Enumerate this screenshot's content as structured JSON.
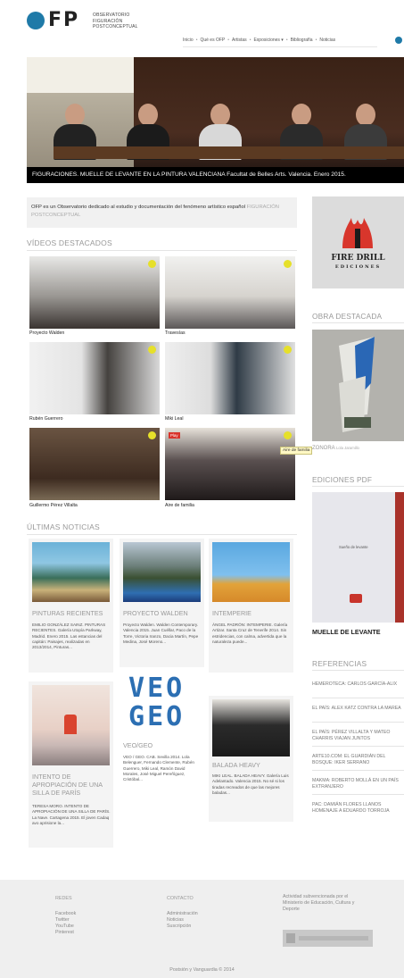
{
  "header": {
    "logo_letters": "FP",
    "logo_text": [
      "OBSERVATORIO",
      "FIGURACIÓN",
      "POSTCONCEPTUAL"
    ],
    "nav": [
      "Inicio",
      "Qué es OFP",
      "Artistas",
      "Exposiciones ▾",
      "Bibliografía",
      "Noticias"
    ]
  },
  "hero": {
    "caption": "FIGURACIONES. MUELLE DE LEVANTE EN LA PINTURA VALENCIANA Facultat de Belles Arts. Valencia. Enero 2015."
  },
  "intro": {
    "text": "OFP es un Observatorio dedicado al estudio y documentación del fenómeno artístico español",
    "muted": "FIGURACIÓN POSTCONCEPTUAL"
  },
  "videos": {
    "title": "VÍDEOS DESTACADOS",
    "items": [
      {
        "label": "Proyecto Walden"
      },
      {
        "label": "Travesías"
      },
      {
        "label": "Rubén Guerrero"
      },
      {
        "label": "Miki Leal"
      },
      {
        "label": "Guillermo Pérez Villalta"
      },
      {
        "label": "Aire de familia"
      }
    ],
    "tooltip": "Aire de familia",
    "badge": "Play"
  },
  "sidebar": {
    "logo_title": "FIRE DRILL",
    "logo_subtitle": "EDICIONES",
    "obra_title": "OBRA DESTACADA",
    "obra_caption": "ZONORA",
    "obra_author": "Lola Jaramillo",
    "pdf_title": "EDICIONES PDF",
    "pdf_cover_text": "Sueño de levante",
    "pdf_caption": "MUELLE DE LEVANTE",
    "refs_title": "REFERENCIAS",
    "refs": [
      "HEMEROTECA: CARLOS GARCÍA-ALIX",
      "EL PAÍS: ALEX KATZ CONTRA LA MAREA",
      "EL PAÍS: PÉREZ VILLALTA Y MATEO CHARRIS VIAJAN JUNTOS",
      "ARTE10.COM: EL GUARDIÁN DEL BOSQUE: IKER SERRANO",
      "MAKMA: ROBERTO MOLLÁ EN UN PAÍS EXTRANJERO",
      "PAC: DAMIÁN FLORES LLANOS HOMENAJE A EDUARDO TORROJA"
    ]
  },
  "news": {
    "title": "ÚLTIMAS NOTICIAS",
    "items": [
      {
        "title": "PINTURAS RECIENTES",
        "text": "EMILIO GONZÁLEZ SAINZ. PINTURAS RECIENTES. Galería Utopía Parkway, Madrid. Enero 2015. Las estancias del capitán: Paisajes, realizadas en 2013/2014, Pinturas..."
      },
      {
        "title": "PROYECTO WALDEN",
        "text": "Proyecto Walden. Walden Contemporary. Valencia 2015. Juan Cuéllar, Paco de la Torre, Victoria Iranzo, Dacia Martín, Pepe Medina, José Moreno..."
      },
      {
        "title": "INTEMPERIE",
        "text": "ÁNGEL PADRÓN: INTEMPERIE. Galería Artizar. Santa Cruz de Tenerife 2014. Sin estridencias, con calma, advertida que la naturaleza puede..."
      },
      {
        "title": "INTENTO DE APROPIACIÓN DE UNA SILLA DE PARÍS",
        "text": "TERESA MORO. INTENTO DE APROPIACIÓN DE UNA SILLA DE PARÍS. La Nave. Cartagena 2015. El joven Cadaq avo aprisione la..."
      },
      {
        "title": "VEO/GEO",
        "text": "VEO / GEO. CAB. Sevilla 2014. Lola Belenguer, Fernando Clemente, Rubén Guerrero, Miki Leal, Ramón David Morales, José Miguel Pereñíguez, Cristóbal..."
      },
      {
        "title": "BALADA HEAVY",
        "text": "MIKI LEAL. BALADA HEAVY. Galería Luis Adelantado. Valencia 2015. No sé si los tiradas recreados de que las mejores baladas..."
      }
    ],
    "veo_letters": [
      "V",
      "E",
      "O",
      "G",
      "E",
      "O"
    ]
  },
  "footer": {
    "col1_title": "REDES",
    "col1_items": [
      "Facebook",
      "Twitter",
      "YouTube",
      "Pinterest"
    ],
    "col2_title": "CONTACTO",
    "col2_items": [
      "Administración",
      "Noticias",
      "Suscripción"
    ],
    "col3_text": "Actividad subvencionada por el Ministerio de Educación, Cultura y Deporte",
    "copyright": "Postsión y Vanguardia © 2014"
  }
}
